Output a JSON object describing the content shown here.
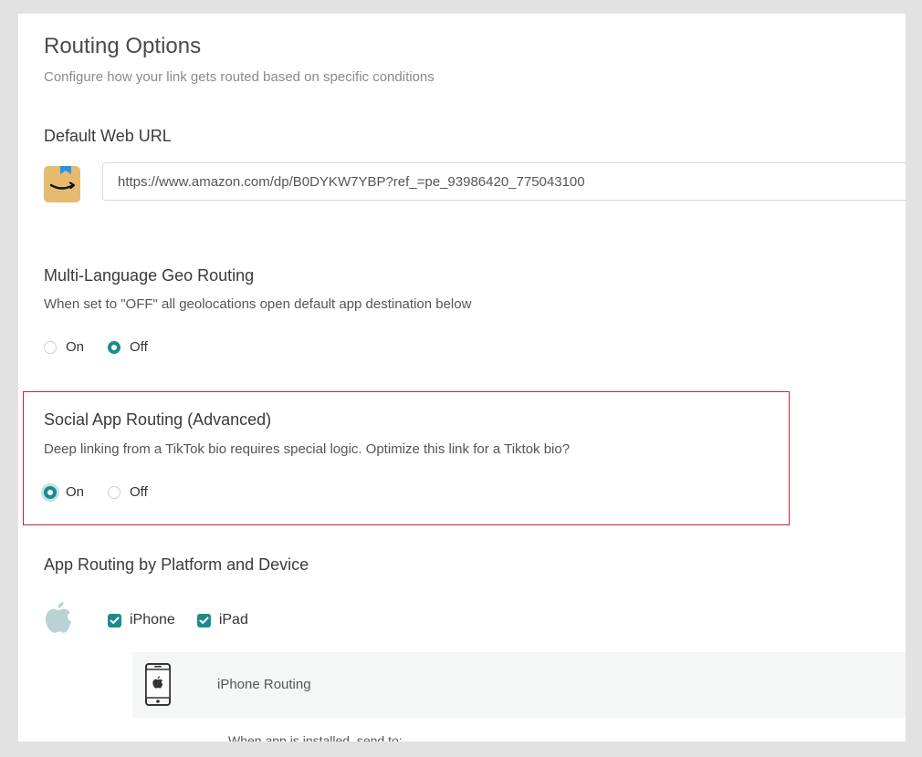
{
  "header": {
    "title": "Routing Options",
    "subtitle": "Configure how your link gets routed based on specific conditions"
  },
  "default_url": {
    "title": "Default Web URL",
    "value": "https://www.amazon.com/dp/B0DYKW7YBP?ref_=pe_93986420_775043100"
  },
  "geo_routing": {
    "title": "Multi-Language Geo Routing",
    "description": "When set to \"OFF\" all geolocations open default app destination below",
    "options": [
      {
        "label": "On",
        "selected": false
      },
      {
        "label": "Off",
        "selected": true
      }
    ]
  },
  "social_routing": {
    "title": "Social App Routing (Advanced)",
    "description": "Deep linking from a TikTok bio requires special logic. Optimize this link for a Tiktok bio?",
    "options": [
      {
        "label": "On",
        "selected": true
      },
      {
        "label": "Off",
        "selected": false
      }
    ],
    "highlight_color": "#c9252f"
  },
  "app_routing": {
    "title": "App Routing by Platform and Device",
    "platform_icon": "apple-icon",
    "devices": [
      {
        "label": "iPhone",
        "checked": true
      },
      {
        "label": "iPad",
        "checked": true
      }
    ],
    "iphone_routing": {
      "title": "iPhone Routing",
      "icon": "iphone-icon",
      "installed_label": "When app is installed, send to:"
    }
  },
  "colors": {
    "accent": "#1a8c8c",
    "highlight": "#c9252f",
    "amazon_tile": "#e6ba6f"
  }
}
